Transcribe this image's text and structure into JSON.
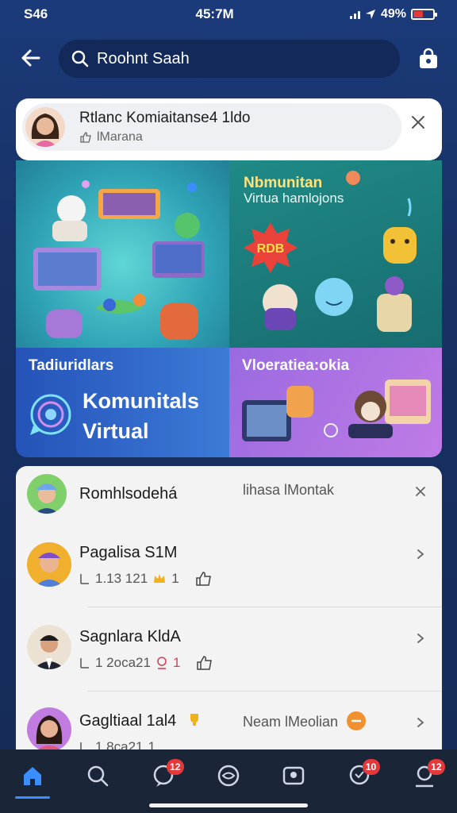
{
  "status": {
    "time": "S46",
    "center_time": "45:7M",
    "battery_pct": "49%",
    "battery_level": 0.49
  },
  "search": {
    "value": "Roohnt Saah",
    "placeholder": "Roohnt Saah"
  },
  "pill": {
    "title": "Rtlanc Komiaitanse4 1ldo",
    "subtitle": "lMarana"
  },
  "tiles": [
    {
      "label": ""
    },
    {
      "label": "Nbmunitan",
      "sublabel": "Virtua hamlojons",
      "badge_text": "RDB"
    },
    {
      "label": "Tadiuridlars",
      "big_line1": "Komunitals",
      "big_line2": "Virtual"
    },
    {
      "label": "Vloeratiea:okia"
    }
  ],
  "rows": [
    {
      "title": "Romhlsodehá",
      "right": "lihasa lMontak",
      "meta": ""
    },
    {
      "title": "Pagalisa S1M",
      "meta_count": "1.13 121",
      "meta_extra": "1"
    },
    {
      "title": "Sagnlara KldA",
      "meta_count": "1 2oca21",
      "meta_extra": "1"
    },
    {
      "title": "Gagltiaal 1al4",
      "right": "Neam lMeolian",
      "meta_count": "1 8ca21",
      "meta_extra": "1"
    }
  ],
  "nav": [
    {
      "icon": "home-icon",
      "badge": ""
    },
    {
      "icon": "search-icon",
      "badge": ""
    },
    {
      "icon": "chat-icon",
      "badge": "12"
    },
    {
      "icon": "eye-icon",
      "badge": ""
    },
    {
      "icon": "media-icon",
      "badge": ""
    },
    {
      "icon": "call-icon",
      "badge": "10"
    },
    {
      "icon": "profile-icon",
      "badge": "12"
    }
  ],
  "colors": {
    "accent": "#3b8eff",
    "badge": "#e5383b",
    "nav_bg": "#1b2538"
  }
}
